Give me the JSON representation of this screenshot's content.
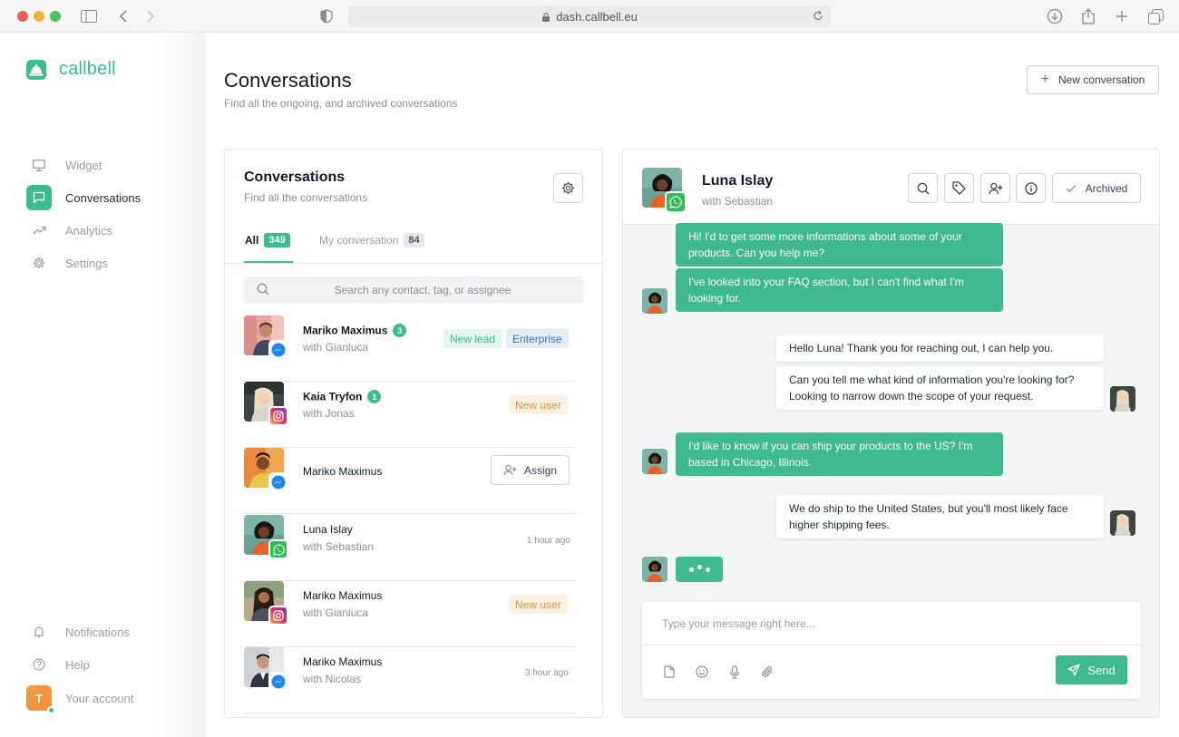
{
  "browser": {
    "url": "dash.callbell.eu"
  },
  "brand": {
    "name": "callbell",
    "accent": "#3bbd8f"
  },
  "sidebar": {
    "items": [
      {
        "label": "Widget",
        "icon": "monitor-icon"
      },
      {
        "label": "Conversations",
        "icon": "chat-icon",
        "active": true
      },
      {
        "label": "Analytics",
        "icon": "trend-icon"
      },
      {
        "label": "Settings",
        "icon": "gear-icon"
      }
    ],
    "bottom": [
      {
        "label": "Notifications",
        "icon": "bell-icon"
      },
      {
        "label": "Help",
        "icon": "help-icon"
      },
      {
        "label": "Your account",
        "avatar_initial": "T"
      }
    ]
  },
  "page": {
    "title": "Conversations",
    "subtitle": "Find all the ongoing, and archived conversations",
    "new_button": "New conversation"
  },
  "list": {
    "title": "Conversations",
    "subtitle": "Find all the conversations",
    "tabs": [
      {
        "label": "All",
        "count": "349"
      },
      {
        "label": "My conversation",
        "count": "84"
      }
    ],
    "search_placeholder": "Search any contact, tag, or assignee",
    "assign_label": "Assign",
    "conversations": [
      {
        "name": "Mariko Maximus",
        "with": "with Gianluca",
        "unread": "3",
        "channel": "messenger",
        "tags": [
          "New lead",
          "Enterprise"
        ]
      },
      {
        "name": "Kaia Tryfon",
        "with": "with Jonas",
        "unread": "1",
        "channel": "instagram",
        "tags": [
          "New user"
        ]
      },
      {
        "name": "Mariko Maximus",
        "with": "",
        "channel": "messenger",
        "action": "Assign"
      },
      {
        "name": "Luna Islay",
        "with": "with Sebastian",
        "channel": "whatsapp",
        "time": "1 hour ago"
      },
      {
        "name": "Mariko Maximus",
        "with": "with Gianluca",
        "channel": "instagram",
        "tags": [
          "New user"
        ]
      },
      {
        "name": "Mariko Maximus",
        "with": "with Nicolas",
        "channel": "messenger",
        "time": "3 hour ago"
      }
    ]
  },
  "chat": {
    "contact": "Luna Islay",
    "with": "with Sebastian",
    "archived_label": "Archived",
    "messages": [
      {
        "from": "contact",
        "text": "Hi! I'd to get some more informations about some of your products. Can you help me?"
      },
      {
        "from": "contact",
        "text": "I've looked into your FAQ section, but I can't find what I'm looking for."
      },
      {
        "from": "agent",
        "text": "Hello Luna! Thank you for reaching out, I can help you."
      },
      {
        "from": "agent",
        "text": "Can you tell me what kind of information you're looking for? Looking to narrow down the scope of your request."
      },
      {
        "from": "contact",
        "text": "I'd like to know if you can ship your products to the US? I'm based in Chicago, Illinois."
      },
      {
        "from": "agent",
        "text": "We do ship to the United States, but you'll most likely face higher shipping fees."
      }
    ],
    "composer_placeholder": "Type your message right here...",
    "send_label": "Send"
  }
}
